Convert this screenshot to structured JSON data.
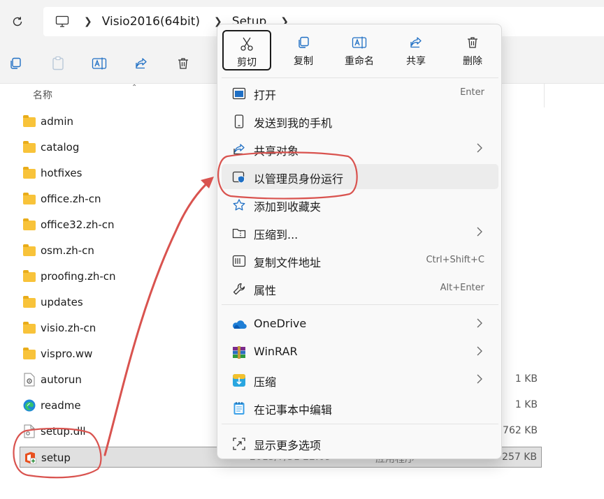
{
  "address_bar": {
    "crumbs": [
      "Visio2016(64bit)",
      "Setup"
    ]
  },
  "toolbar": {
    "icons": [
      "copy-icon",
      "paste-icon",
      "rename-icon",
      "share-icon",
      "delete-icon"
    ]
  },
  "file_list": {
    "column_name": "名称",
    "rows": [
      {
        "name": "admin",
        "kind": "folder",
        "size": ""
      },
      {
        "name": "catalog",
        "kind": "folder",
        "size": ""
      },
      {
        "name": "hotfixes",
        "kind": "folder",
        "size": ""
      },
      {
        "name": "office.zh-cn",
        "kind": "folder",
        "size": ""
      },
      {
        "name": "office32.zh-cn",
        "kind": "folder",
        "size": ""
      },
      {
        "name": "osm.zh-cn",
        "kind": "folder",
        "size": ""
      },
      {
        "name": "proofing.zh-cn",
        "kind": "folder",
        "size": ""
      },
      {
        "name": "updates",
        "kind": "folder",
        "size": ""
      },
      {
        "name": "visio.zh-cn",
        "kind": "folder",
        "size": ""
      },
      {
        "name": "vispro.ww",
        "kind": "folder",
        "size": ""
      },
      {
        "name": "autorun",
        "kind": "settings-file",
        "size": "1 KB"
      },
      {
        "name": "readme",
        "kind": "edge-html",
        "size": "1 KB"
      },
      {
        "name": "setup.dll",
        "kind": "dll",
        "size": "762 KB"
      },
      {
        "name": "setup",
        "kind": "office-exe",
        "size": "257 KB",
        "date": "2015/7/31 22:09",
        "type": "应用程序",
        "selected": true
      }
    ]
  },
  "context_menu": {
    "quick_actions": [
      {
        "label": "剪切",
        "icon": "scissors-icon",
        "active": true
      },
      {
        "label": "复制",
        "icon": "copy-icon"
      },
      {
        "label": "重命名",
        "icon": "rename-icon"
      },
      {
        "label": "共享",
        "icon": "share-icon"
      },
      {
        "label": "删除",
        "icon": "delete-icon"
      }
    ],
    "open": {
      "label": "打开",
      "shortcut": "Enter"
    },
    "send_to_phone": {
      "label": "发送到我的手机"
    },
    "share_object": {
      "label": "共享对象"
    },
    "run_as_admin": {
      "label": "以管理员身份运行"
    },
    "add_favorites": {
      "label": "添加到收藏夹"
    },
    "compress_to": {
      "label": "压缩到..."
    },
    "copy_path": {
      "label": "复制文件地址",
      "shortcut": "Ctrl+Shift+C"
    },
    "properties": {
      "label": "属性",
      "shortcut": "Alt+Enter"
    },
    "onedrive": {
      "label": "OneDrive"
    },
    "winrar": {
      "label": "WinRAR"
    },
    "compress": {
      "label": "压缩"
    },
    "notepad_edit": {
      "label": "在记事本中编辑"
    },
    "more_options": {
      "label": "显示更多选项"
    }
  },
  "colors": {
    "annotation_red": "#d9534f",
    "accent_blue": "#0067c0",
    "folder_yellow": "#f8c33a",
    "office_red": "#e8501f"
  }
}
